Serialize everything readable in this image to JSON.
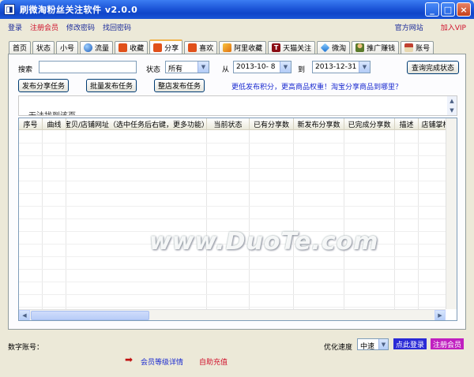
{
  "window": {
    "title": "刷微淘粉丝关注软件 v2.0.0"
  },
  "menu": {
    "left": [
      {
        "label": "登录",
        "color": "blue"
      },
      {
        "label": "注册会员",
        "color": "red"
      },
      {
        "label": "修改密码",
        "color": "blue"
      },
      {
        "label": "找回密码",
        "color": "blue"
      }
    ],
    "official_site": "官方网站",
    "join_vip": "加入VIP"
  },
  "tabs": [
    {
      "label": "首页",
      "icon": ""
    },
    {
      "label": "状态",
      "icon": ""
    },
    {
      "label": "小号",
      "icon": ""
    },
    {
      "label": "流量",
      "icon": "globe-icon",
      "icon_color": "#2a7ad6"
    },
    {
      "label": "收藏",
      "icon": "taobao-icon",
      "icon_color": "#e0501a"
    },
    {
      "label": "分享",
      "icon": "taobao-icon",
      "icon_color": "#e0501a",
      "active": true
    },
    {
      "label": "喜欢",
      "icon": "taobao-icon",
      "icon_color": "#e0501a"
    },
    {
      "label": "阿里收藏",
      "icon": "ali-icon",
      "icon_color": "#f0a010"
    },
    {
      "label": "天猫关注",
      "icon": "tmall-icon",
      "icon_color": "#c0101a"
    },
    {
      "label": "微淘",
      "icon": "diamond-icon",
      "icon_color": "#2a8ae0"
    },
    {
      "label": "推广赚钱",
      "icon": "people-icon",
      "icon_color": "#5a7a2a"
    },
    {
      "label": "账号",
      "icon": "house-icon",
      "icon_color": "#b03020"
    }
  ],
  "filters": {
    "search_label": "搜索",
    "search_value": "",
    "status_label": "状态",
    "status_value": "所有",
    "from_label": "从",
    "from_date": "2013-10- 8",
    "to_label": "到",
    "to_date": "2013-12-31",
    "query_button": "查询完成状态"
  },
  "actions": {
    "publish_share": "发布分享任务",
    "batch_publish": "批量发布任务",
    "shop_publish": "整店发布任务",
    "promo_link": "更低发布积分，更高商品权重！淘宝分享商品到哪里？"
  },
  "notice": {
    "text": "无法找到该页"
  },
  "table": {
    "columns": [
      "序号",
      "曲线",
      "宝贝/店铺网址（选中任务后右键，更多功能）",
      "当前状态",
      "已有分享数",
      "新发布分享数",
      "已完成分享数",
      "描述",
      "店铺掌柜"
    ],
    "rows": []
  },
  "watermark": "www.DuoTe.com",
  "footer": {
    "digital_account_label": "数字账号：",
    "optimize_speed_label": "优化速度",
    "speed_value": "中速",
    "login_button": "点此登录",
    "register_button": "注册会员",
    "member_level_link": "会员等级详情",
    "auto_recharge_link": "自助充值"
  },
  "colors": {
    "title_blue": "#1d56d8",
    "link_blue": "#1a2ad0",
    "link_red": "#d0112b",
    "login_btn": "#2a2ad6",
    "register_btn": "#c020c0"
  }
}
